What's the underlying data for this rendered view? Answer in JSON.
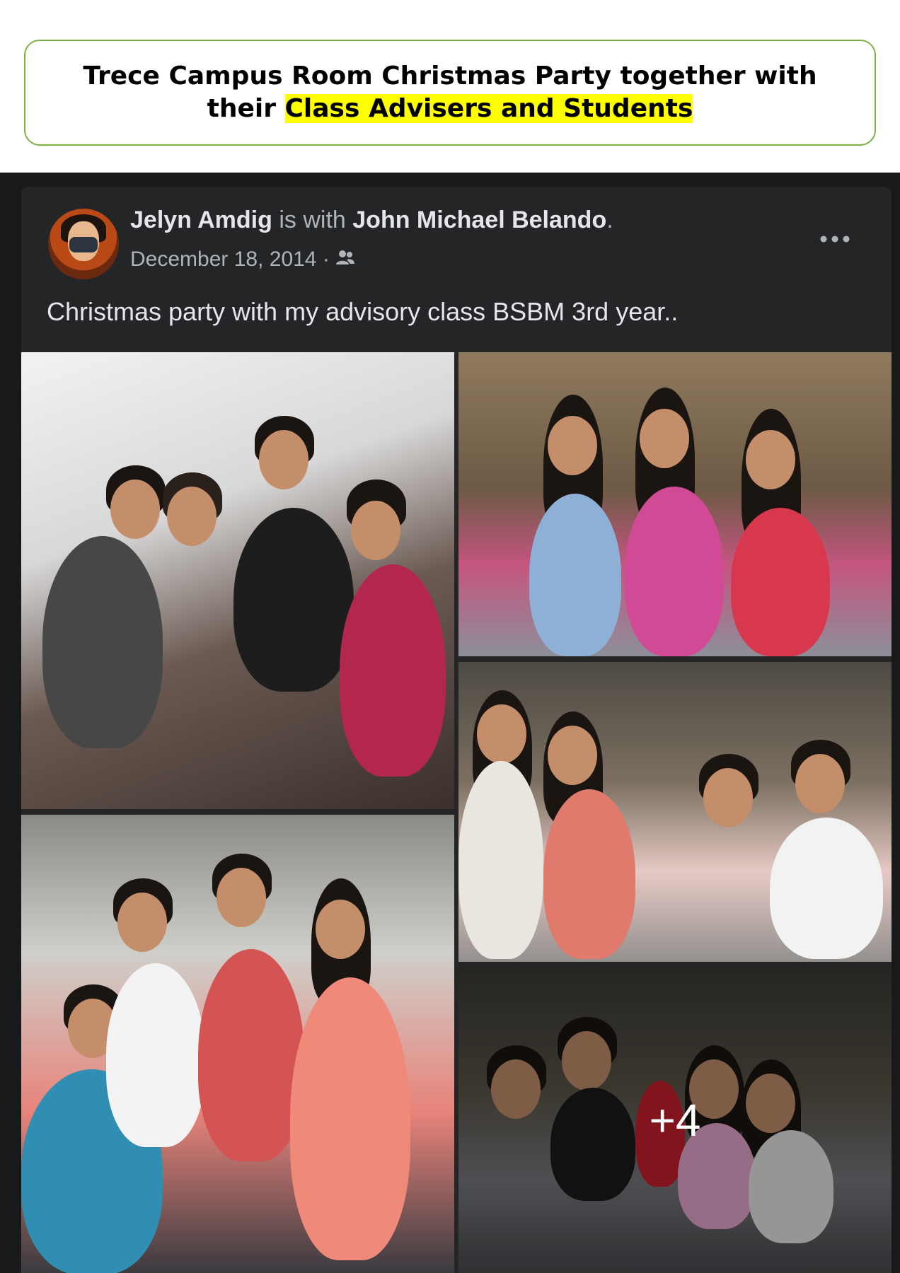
{
  "banner": {
    "line1": "Trece Campus Room Christmas Party together with",
    "line2_plain": "their ",
    "line2_highlight": "Class Advisers and Students"
  },
  "post": {
    "author": "Jelyn Amdig",
    "with_text": " is with ",
    "tagged": "John Michael Belando",
    "tagged_suffix": ".",
    "date": "December 18, 2014 · ",
    "audience_icon": "friends-icon",
    "more_icon": "more-options-icon",
    "caption": "Christmas party with my advisory class BSBM 3rd year.."
  },
  "gallery": {
    "photos": [
      {
        "desc": "group-photo-1"
      },
      {
        "desc": "group-photo-2"
      },
      {
        "desc": "group-photo-3"
      },
      {
        "desc": "group-photo-4"
      },
      {
        "desc": "group-photo-5"
      }
    ],
    "more_count": "+4"
  }
}
